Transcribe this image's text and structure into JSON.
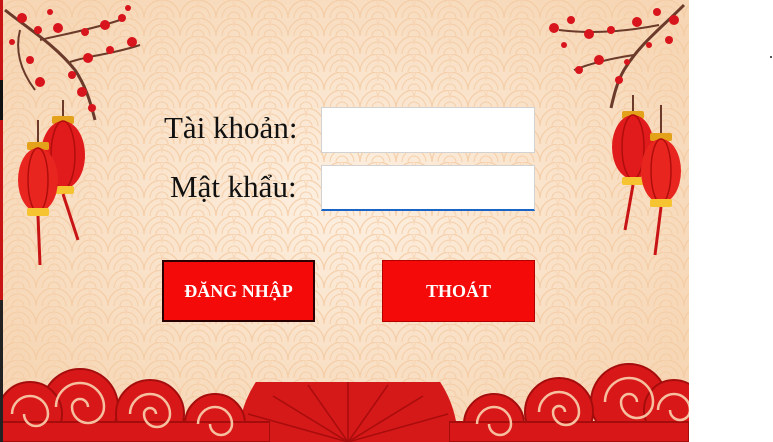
{
  "login": {
    "username_label": "Tài khoản:",
    "password_label": "Mật khẩu:",
    "username_value": "",
    "password_value": ""
  },
  "buttons": {
    "login_label": "ĐĂNG NHẬP",
    "exit_label": "THOÁT"
  },
  "colors": {
    "background": "#f8dcbf",
    "button_red": "#f50a0a",
    "button_text": "#ffffff",
    "focus_underline": "#1a64c8"
  },
  "decor_icons": [
    "plum-blossom-branch-icon",
    "red-lantern-icon",
    "auspicious-cloud-icon",
    "hand-fan-icon"
  ]
}
